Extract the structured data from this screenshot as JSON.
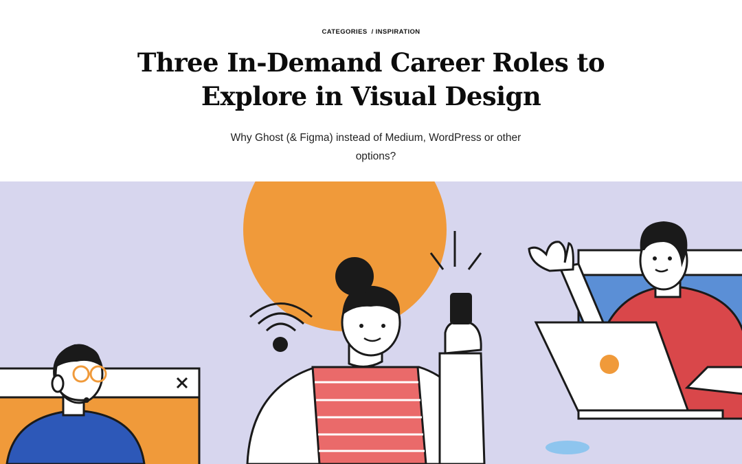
{
  "breadcrumb": {
    "categories": "CATEGORIES",
    "separator": "/",
    "current": "INSPIRATION"
  },
  "article": {
    "title": "Three In-Demand Career Roles to Explore in Visual Design",
    "subtitle": "Why Ghost (& Figma) instead of Medium, WordPress or other options?"
  },
  "hero": {
    "icons": [
      "close-icon",
      "wifi-icon",
      "smartphone-icon",
      "laptop-icon",
      "headset-icon"
    ],
    "colors": {
      "background": "#d7d6ee",
      "sun": "#f09a3a",
      "outline": "#1a1a1a",
      "shirt_blue": "#2d58b8",
      "shirt_red": "#d9474a",
      "stripes": "#ea6a6a",
      "window_blue": "#5b8fd6",
      "puddle": "#8ec5ee"
    }
  }
}
